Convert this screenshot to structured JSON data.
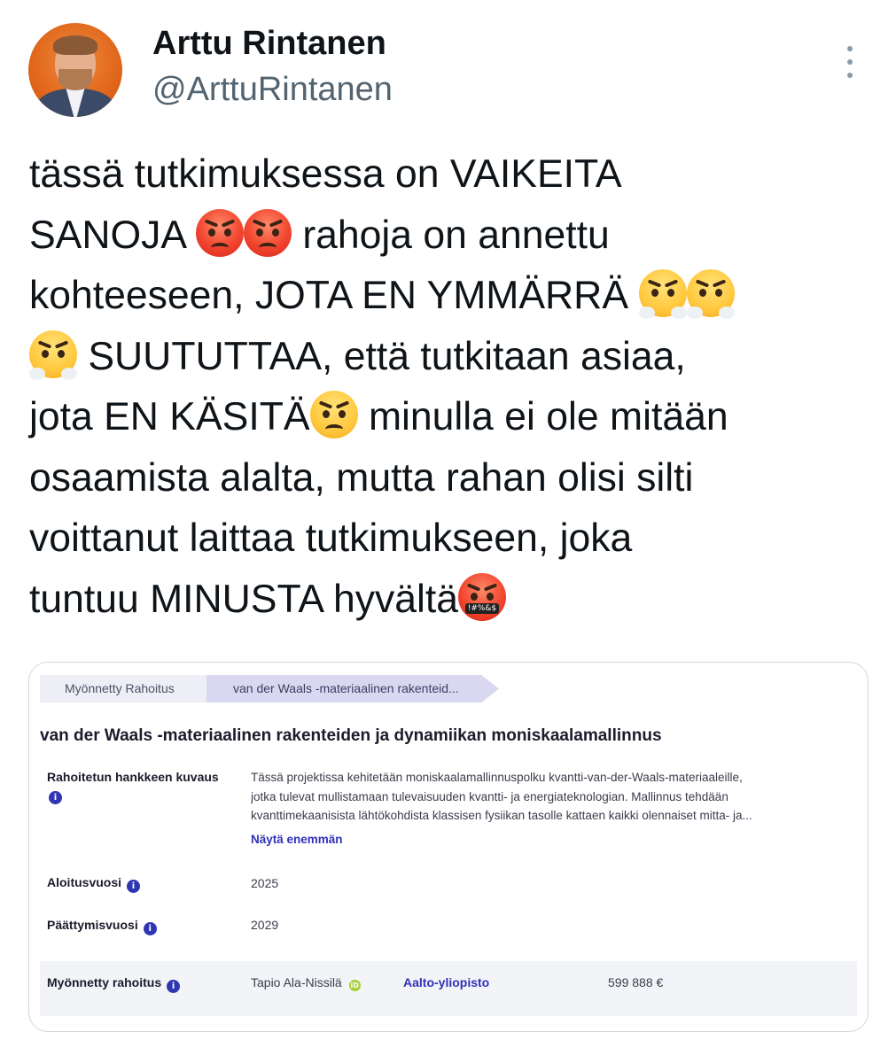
{
  "author": {
    "display_name": "Arttu Rintanen",
    "handle": "@ArttuRintanen",
    "avatar_icon": "profile-photo",
    "more_icon": "more-vertical-icon"
  },
  "tweet": {
    "lines": [
      {
        "segments": [
          "tässä tutkimuksessa on VAIKEITA"
        ]
      },
      {
        "segments": [
          "SANOJA ",
          " rahoja on annettu"
        ]
      },
      {
        "segments": [
          "kohteeseen, JOTA EN YMMÄRRÄ "
        ]
      },
      {
        "segments": [
          " SUUTUTTAA, että tutkitaan asiaa,"
        ]
      },
      {
        "segments": [
          "jota EN KÄSITÄ",
          " minulla ei ole mitään"
        ]
      },
      {
        "segments": [
          "osaamista alalta, mutta rahan olisi silti"
        ]
      },
      {
        "segments": [
          "voittanut laittaa tutkimukseen, joka"
        ]
      },
      {
        "segments": [
          "tuntuu MINUSTA hyvältä"
        ]
      }
    ],
    "emoji": {
      "angry": "angry-face-emoji",
      "steam": "face-with-steam-from-nose-emoji",
      "pout": "pouting-face-emoji",
      "curse": "face-with-symbols-on-mouth-emoji",
      "curse_symbols": "!#%&$"
    }
  },
  "card": {
    "breadcrumb": [
      "Myönnetty Rahoitus",
      "van der Waals -materiaalinen rakenteid..."
    ],
    "title": "van der Waals -materiaalinen rakenteiden ja dynamiikan moniskaalamallinnus",
    "description_label": "Rahoitetun hankkeen kuvaus",
    "description_lines": [
      "Tässä projektissa kehitetään moniskaalamallinnuspolku kvantti-van-der-Waals-materiaaleille,",
      "jotka tulevat mullistamaan tulevaisuuden kvantti- ja energiateknologian. Mallinnus tehdään",
      "kvanttimekaanisista lähtökohdista klassisen fysiikan tasolle kattaen kaikki olennaiset mitta- ja..."
    ],
    "show_more": "Näytä enemmän",
    "start_label": "Aloitusvuosi",
    "start_year": "2025",
    "end_label": "Päättymisvuosi",
    "end_year": "2029",
    "funding_label": "Myönnetty rahoitus",
    "recipient": "Tapio Ala-Nissilä",
    "organization": "Aalto-yliopisto",
    "amount": "599 888 €",
    "info_icon": "info-icon",
    "orcid_icon": "orcid-icon"
  },
  "colors": {
    "text": "#0f1419",
    "secondary": "#536471",
    "link": "#3131b8",
    "breadcrumb_bg": "#d9d8f0"
  }
}
